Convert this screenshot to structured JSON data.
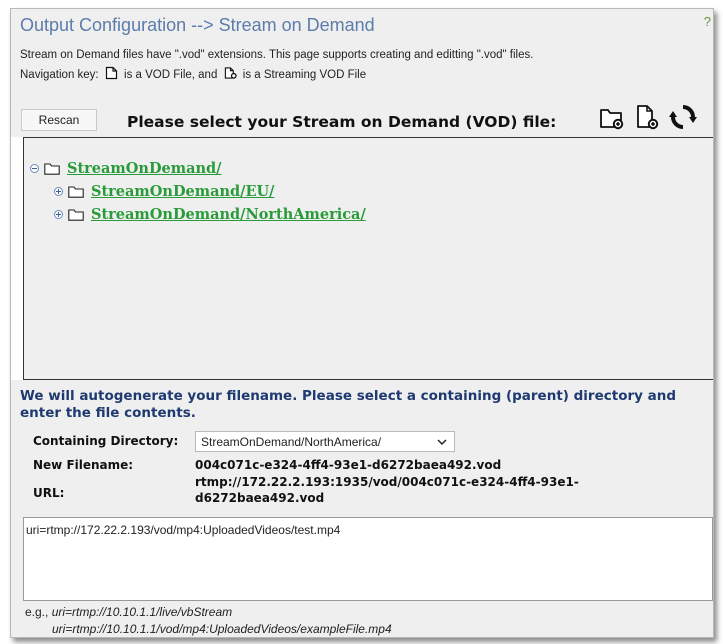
{
  "header": {
    "title": "Output Configuration --> Stream on Demand",
    "help": "?",
    "description_line1": "Stream on Demand files have \".vod\" extensions. This page supports creating and editting \".vod\" files.",
    "nav_prefix": "Navigation key:",
    "nav_middle": "is a VOD File, and",
    "nav_suffix": "is a Streaming VOD File"
  },
  "toolbar": {
    "rescan_label": "Rescan",
    "select_prompt": "Please select your Stream on Demand (VOD) file:",
    "icons": [
      "new-folder-icon",
      "new-file-icon",
      "refresh-icon"
    ]
  },
  "tree": {
    "root": "StreamOnDemand/",
    "children": [
      "StreamOnDemand/EU/",
      "StreamOnDemand/NorthAmerica/"
    ]
  },
  "form": {
    "autogen_text": "We will autogenerate your filename. Please select a containing (parent) directory and enter the file contents.",
    "containing_dir_label": "Containing Directory:",
    "containing_dir_value": "StreamOnDemand/NorthAmerica/",
    "new_filename_label": "New Filename:",
    "new_filename_value": "004c071c-e324-4ff4-93e1-d6272baea492.vod",
    "url_label": "URL:",
    "url_value_line1": "rtmp://172.22.2.193:1935/vod/004c071c-e324-4ff4-93e1-",
    "url_value_line2": "d6272baea492.vod",
    "contents": "uri=rtmp://172.22.2.193/vod/mp4:UploadedVideos/test.mp4",
    "example_prefix": "e.g.,",
    "example_line1": "uri=rtmp://10.10.1.1/live/vbStream",
    "example_line2": "uri=rtmp://10.10.1.1/vod/mp4:UploadedVideos/exampleFile.mp4"
  },
  "colors": {
    "title": "#5c7cab",
    "link": "#2a9b3a",
    "autogen": "#1f3a70",
    "panel_bg": "#efefef"
  }
}
